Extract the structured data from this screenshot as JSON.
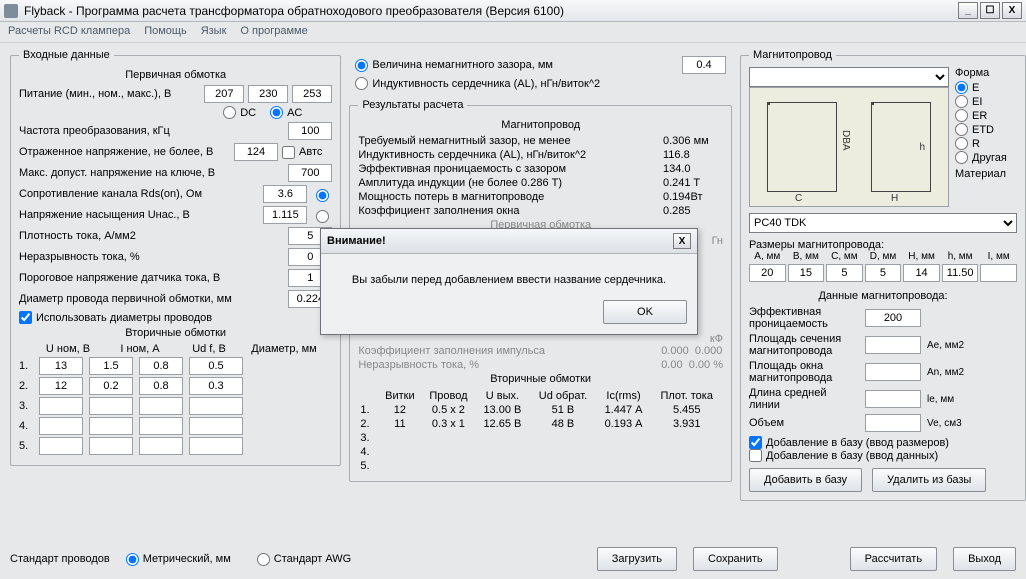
{
  "window": {
    "title": "Flyback - Программа расчета трансформатора обратноходового преобразователя (Версия 6100)"
  },
  "menu": {
    "rcd": "Расчеты RCD клампера",
    "help": "Помощь",
    "lang": "Язык",
    "about": "О программе"
  },
  "input": {
    "legend": "Входные данные",
    "primary": "Первичная обмотка",
    "supply_lbl": "Питание (мин., ном., макс.), В",
    "supply_min": "207",
    "supply_nom": "230",
    "supply_max": "253",
    "dc": "DC",
    "ac": "AC",
    "freq_lbl": "Частота преобразования, кГц",
    "freq": "100",
    "vor_lbl": "Отраженное напряжение, не более, В",
    "vor": "124",
    "auto": "Автс",
    "vds_lbl": "Макс. допуст. напряжение на ключе, В",
    "vds": "700",
    "rds_lbl": "Сопротивление канала Rds(on), Ом",
    "rds": "3.6",
    "usat_lbl": "Напряжение насыщения Uнас., В",
    "usat": "1.115",
    "jcur_lbl": "Плотность тока, А/мм2",
    "jcur": "5",
    "irip_lbl": "Неразрывность тока, %",
    "irip": "0",
    "vcs_lbl": "Пороговое напряжение датчика тока, В",
    "vcs": "1",
    "dwire_lbl": "Диаметр провода первичной обмотки, мм",
    "dwire": "0.224",
    "usedia_lbl": "Использовать диаметры проводов",
    "sec_legend": "Вторичные обмотки",
    "c_unom": "U ном, В",
    "c_inom": "I ном, А",
    "c_uf": "Ud f, В",
    "c_dia": "Диаметр, мм",
    "rows": [
      {
        "n": "1.",
        "u": "13",
        "i": "1.5",
        "uf": "0.8",
        "d": "0.5"
      },
      {
        "n": "2.",
        "u": "12",
        "i": "0.2",
        "uf": "0.8",
        "d": "0.3"
      },
      {
        "n": "3.",
        "u": "",
        "i": "",
        "uf": "",
        "d": ""
      },
      {
        "n": "4.",
        "u": "",
        "i": "",
        "uf": "",
        "d": ""
      },
      {
        "n": "5.",
        "u": "",
        "i": "",
        "uf": "",
        "d": ""
      }
    ]
  },
  "mid": {
    "opt_gap": "Величина немагнитного зазора, мм",
    "opt_al": "Индуктивность сердечника (AL), нГн/виток^2",
    "gap_val": "0.4",
    "res_legend": "Результаты расчета",
    "mag_hdr": "Магнитопровод",
    "r_gap_lbl": "Требуемый немагнитный зазор, не менее",
    "r_gap": "0.306 мм",
    "r_al_lbl": "Индуктивность сердечника (AL), нГн/виток^2",
    "r_al": "116.8",
    "r_mu_lbl": "Эффективная проницаемость с зазором",
    "r_mu": "134.0",
    "r_b_lbl": "Амплитуда индукции    (не более 0.286 T)",
    "r_b": "0.241 T",
    "r_p_lbl": "Мощность потерь в магнитопроводе",
    "r_p": "0.194Вт",
    "r_k_lbl": "Коэффициент заполнения окна",
    "r_k": "0.285",
    "prim_hdr": "Первичная обмотка",
    "cut1": "Гн",
    "cut2": "кФ",
    "fill_lbl": "Коэффициент заполнения импульса",
    "fill_a": "0.000",
    "fill_b": "0.000",
    "rip_lbl": "Неразрывность тока, %",
    "rip_a": "0.00",
    "rip_b": "0.00",
    "rip_c": "%",
    "sec_hdr": "Вторичные обмотки",
    "sc_turns": "Витки",
    "sc_wire": "Провод",
    "sc_uout": "U вых.",
    "sc_urev": "Ud обрат.",
    "sc_irms": "Ic(rms)",
    "sc_j": "Плот. тока",
    "srows": [
      {
        "n": "1.",
        "turns": "12",
        "wire": "0.5 x 2",
        "uout": "13.00 В",
        "urev": "51 В",
        "irms": "1.447 А",
        "j": "5.455"
      },
      {
        "n": "2.",
        "turns": "11",
        "wire": "0.3 x 1",
        "uout": "12.65 В",
        "urev": "48 В",
        "irms": "0.193 А",
        "j": "3.931"
      },
      {
        "n": "3."
      },
      {
        "n": "4."
      },
      {
        "n": "5."
      }
    ]
  },
  "core": {
    "legend": "Магнитопровод",
    "shape_lbl": "Форма",
    "shapes": {
      "e": "E",
      "ei": "EI",
      "er": "ER",
      "etd": "ETD",
      "r": "R",
      "other": "Другая"
    },
    "material_lbl": "Материал",
    "material": "PC40 TDK",
    "dims_lbl": "Размеры магнитопровода:",
    "dims_h": [
      "A, мм",
      "B, мм",
      "C, мм",
      "D, мм",
      "H, мм",
      "h, мм",
      "I, мм"
    ],
    "dims_v": [
      "20",
      "15",
      "5",
      "5",
      "14",
      "11.50",
      ""
    ],
    "data_hdr": "Данные магнитопровода:",
    "mu_lbl": "Эффективная проницаемость",
    "mu": "200",
    "ae_lbl": "Площадь сечения магнитопровода",
    "ae_u": "Ae, мм2",
    "an_lbl": "Площадь окна магнитопровода",
    "an_u": "An, мм2",
    "le_lbl": "Длина средней линии",
    "le_u": "le, мм",
    "ve_lbl": "Объем",
    "ve_u": "Ve, см3",
    "add1": "Добавление в базу (ввод размеров)",
    "add2": "Добавление в базу (ввод данных)",
    "btn_add": "Добавить в базу",
    "btn_del": "Удалить из базы"
  },
  "bottom": {
    "std_lbl": "Стандарт проводов",
    "metric": "Метрический, мм",
    "awg": "Стандарт AWG",
    "load": "Загрузить",
    "save": "Сохранить",
    "calc": "Рассчитать",
    "exit": "Выход"
  },
  "dialog": {
    "title": "Внимание!",
    "msg": "Вы забыли перед добавлением ввести название сердечника.",
    "ok": "OK"
  },
  "diagram": {
    "dba": "DBA",
    "c": "C",
    "h": "h",
    "H": "H"
  }
}
